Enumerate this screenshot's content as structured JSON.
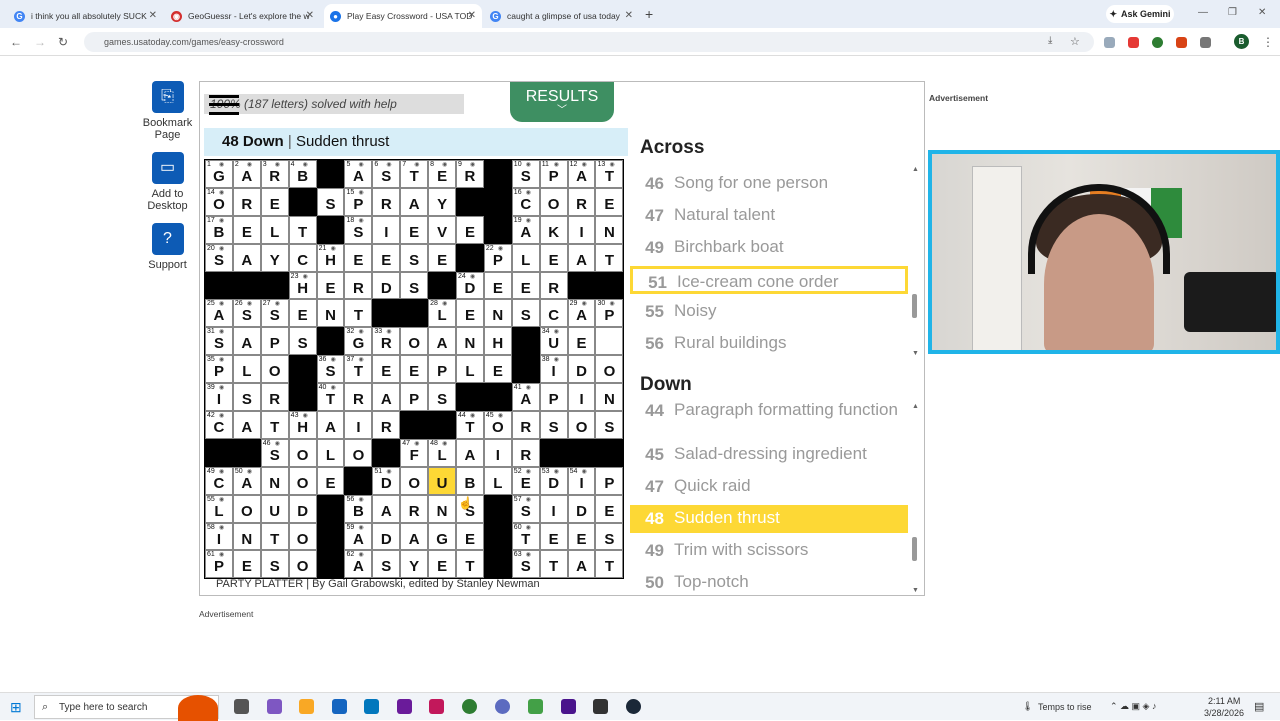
{
  "browser": {
    "tabs": [
      {
        "label": "i think you all absolutely SUCK",
        "icon": "google-icon"
      },
      {
        "label": "GeoGuessr - Let's explore the w",
        "icon": "geoguessr-icon"
      },
      {
        "label": "Play Easy Crossword - USA TOD",
        "icon": "usatoday-icon"
      },
      {
        "label": "caught a glimpse of usa today",
        "icon": "google-icon"
      }
    ],
    "gemini": "Ask Gemini",
    "url": "games.usatoday.com/games/easy-crossword",
    "profile": "B"
  },
  "sidebar": [
    {
      "label": "Bookmark Page",
      "icon": "bookmark-icon"
    },
    {
      "label": "Add to Desktop",
      "icon": "desktop-icon"
    },
    {
      "label": "Support",
      "icon": "help-icon"
    }
  ],
  "game": {
    "solved": "100% (187 letters) solved with help",
    "results": "RESULTS",
    "current_clue_num": "48 Down",
    "current_clue_text": "Sudden thrust",
    "byline": "PARTY PLATTER | By Gail Grabowski, edited by Stanley Newman"
  },
  "grid": {
    "rows": [
      "GARB#ASTER#SPAT",
      "ORE#SPRAY#CORE",
      "BELT#SIEVE#AKIN",
      "SAYCHEESE#PLEAT",
      "###HERDS#DEER###",
      "ASSENT##LENSCAP",
      "SAPS#GROAN#HUE",
      "PLO#STEEPLE#IDO",
      "ISR#TRAPS##APIN",
      "CATHAIR#TORSOS",
      "##SOLO#FLAIR###",
      "CANOE#DOUBLEDIP",
      "LOUD#BARNS#SIDE",
      "INTO#ADAGE#TEES",
      "PESO#ASYET#STAT"
    ],
    "numbers": {
      "0,0": "1",
      "0,1": "2",
      "0,2": "3",
      "0,3": "4",
      "0,5": "5",
      "0,6": "6",
      "0,7": "7",
      "0,8": "8",
      "0,9": "9",
      "0,11": "10",
      "0,12": "11",
      "0,13": "12",
      "0,14": "13",
      "1,0": "14",
      "1,5": "15",
      "1,11": "16",
      "2,0": "17",
      "2,5": "18",
      "2,11": "19",
      "3,0": "20",
      "3,4": "21",
      "3,10": "22",
      "4,3": "23",
      "4,9": "24",
      "5,0": "25",
      "5,1": "26",
      "5,2": "27",
      "5,8": "28",
      "5,13": "29",
      "5,14": "30",
      "6,0": "31",
      "6,5": "32",
      "6,6": "33",
      "6,12": "34",
      "7,0": "35",
      "7,4": "36",
      "7,5": "37",
      "7,12": "38",
      "8,0": "39",
      "8,4": "40",
      "8,11": "41",
      "9,0": "42",
      "9,3": "43",
      "9,9": "44",
      "9,10": "45",
      "10,2": "46",
      "10,7": "47",
      "10,8": "48",
      "11,0": "49",
      "11,1": "50",
      "11,6": "51",
      "11,11": "52",
      "11,12": "53",
      "11,13": "54",
      "12,0": "55",
      "12,5": "56",
      "12,11": "57",
      "13,0": "58",
      "13,5": "59",
      "13,11": "60",
      "14,0": "61",
      "14,5": "62",
      "14,11": "63"
    },
    "highlight": "11,8"
  },
  "across": {
    "title": "Across",
    "clues": [
      {
        "num": "46",
        "text": "Song for one person"
      },
      {
        "num": "47",
        "text": "Natural talent"
      },
      {
        "num": "49",
        "text": "Birchbark boat"
      },
      {
        "num": "51",
        "text": "Ice-cream cone order"
      },
      {
        "num": "55",
        "text": "Noisy"
      },
      {
        "num": "56",
        "text": "Rural buildings"
      }
    ]
  },
  "down": {
    "title": "Down",
    "clues": [
      {
        "num": "44",
        "text": "Paragraph formatting function"
      },
      {
        "num": "45",
        "text": "Salad-dressing ingredient"
      },
      {
        "num": "47",
        "text": "Quick raid"
      },
      {
        "num": "48",
        "text": "Sudden thrust"
      },
      {
        "num": "49",
        "text": "Trim with scissors"
      },
      {
        "num": "50",
        "text": "Top-notch"
      }
    ]
  },
  "ads": {
    "label": "Advertisement"
  },
  "taskbar": {
    "search_placeholder": "Type here to search",
    "weather": "Temps to rise",
    "time": "2:11 AM",
    "date": "3/28/2026"
  }
}
